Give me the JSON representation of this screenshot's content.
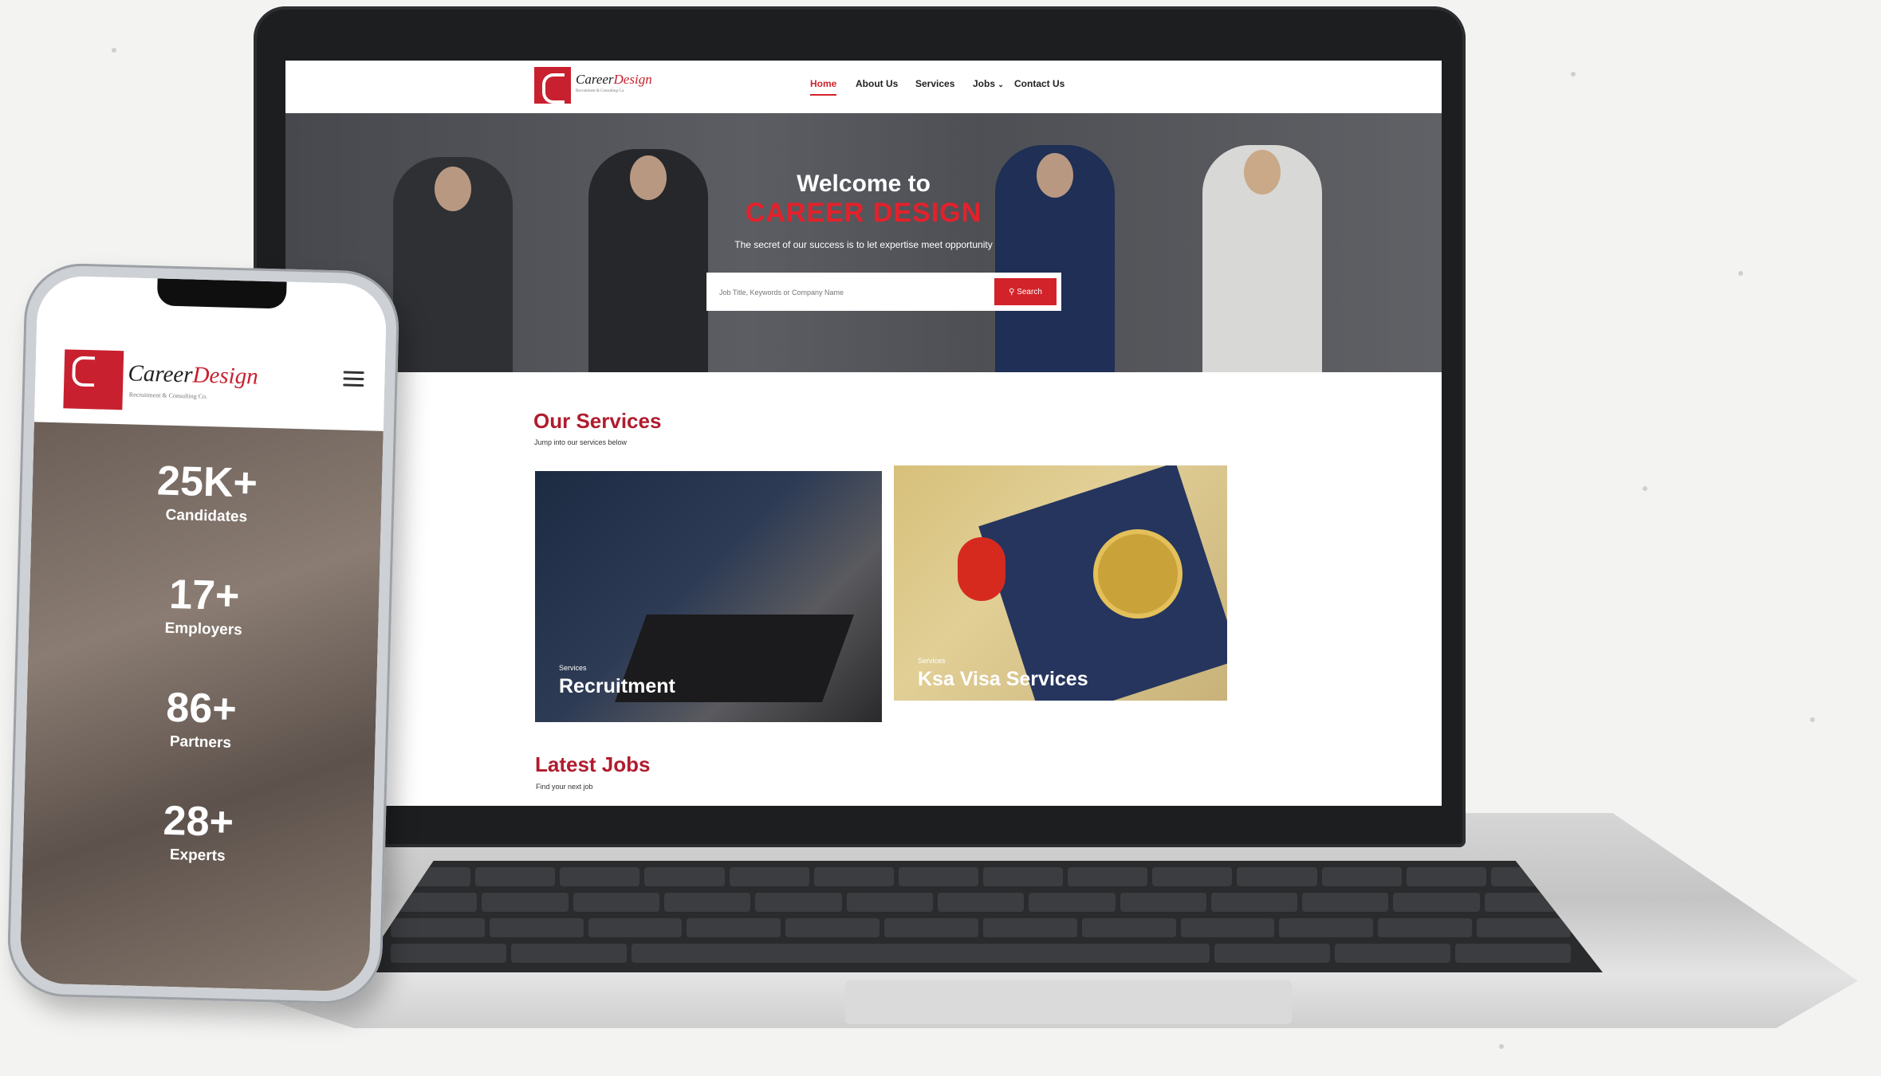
{
  "site": {
    "logo": {
      "name_part1": "Career",
      "name_part2": "Design",
      "tagline": "Recruitment & Consulting Co."
    },
    "nav": [
      {
        "label": "Home",
        "active": true
      },
      {
        "label": "About Us"
      },
      {
        "label": "Services"
      },
      {
        "label": "Jobs"
      },
      {
        "label": "Contact Us"
      }
    ],
    "hero": {
      "title_line1": "Welcome to",
      "title_line2": "CAREER DESIGN",
      "subtitle": "The secret of our success is to let expertise meet opportunity",
      "search_placeholder": "Job Title, Keywords or Company Name",
      "search_button": "Search"
    },
    "services": {
      "title": "Our Services",
      "subtitle": "Jump into our services below",
      "cards": [
        {
          "kicker": "Services",
          "title": "Recruitment"
        },
        {
          "kicker": "Services",
          "title": "Ksa Visa Services"
        }
      ]
    },
    "jobs": {
      "title": "Latest Jobs",
      "subtitle": "Find your next job"
    }
  },
  "mobile": {
    "logo": {
      "name_part1": "Career",
      "name_part2": "Design",
      "tagline": "Recruitment & Consulting Co."
    },
    "stats": [
      {
        "value": "25K+",
        "label": "Candidates"
      },
      {
        "value": "17+",
        "label": "Employers"
      },
      {
        "value": "86+",
        "label": "Partners"
      },
      {
        "value": "28+",
        "label": "Experts"
      }
    ]
  },
  "colors": {
    "brand_red": "#d2232a",
    "title_red": "#b01c2e",
    "laptop_body": "#1d1e20"
  },
  "icons": [
    "search-icon",
    "chevron-down-icon",
    "menu-icon",
    "logo-mark"
  ]
}
